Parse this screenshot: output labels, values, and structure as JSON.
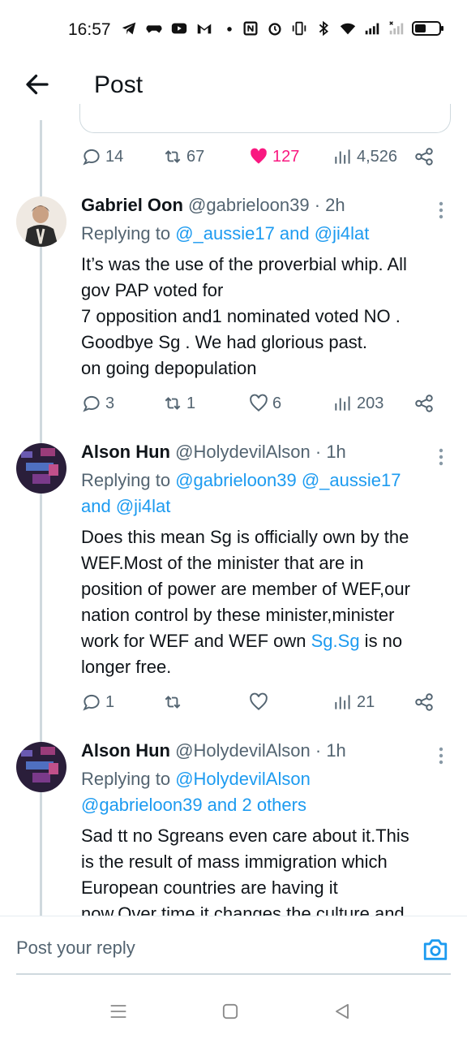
{
  "status_bar": {
    "time": "16:57",
    "icons": [
      "telegram-icon",
      "game-controller-icon",
      "youtube-icon",
      "gmail-icon",
      "dot-icon",
      "nfc-icon",
      "alarm-icon",
      "vibrate-icon",
      "bluetooth-icon",
      "wifi-icon",
      "signal-icon",
      "signal-no-service-icon",
      "battery-icon"
    ],
    "battery_level": 0.45
  },
  "header": {
    "title": "Post"
  },
  "colors": {
    "accent": "#1d9bf0",
    "like": "#f91880",
    "muted": "#536471",
    "text": "#0f1419"
  },
  "top_post_actions": {
    "replies": "14",
    "reposts": "67",
    "likes": "127",
    "views": "4,526"
  },
  "tweets": [
    {
      "name": "Gabriel Oon",
      "handle": "@gabrieloon39",
      "time": "· 2h",
      "replying_prefix": "Replying to ",
      "replying_mentions": "@_aussie17 and @ji4lat",
      "body_lines": [
        "It’s was the use of the proverbial  whip. All",
        "gov PAP voted for",
        "7 opposition and1  nominated voted NO .",
        "Goodbye Sg . We had glorious past.",
        "on going depopulation"
      ],
      "replies": "3",
      "reposts": "1",
      "likes": "6",
      "views": "203"
    },
    {
      "name": "Alson Hun",
      "handle": "@HolydevilAlson",
      "time": "· 1h",
      "replying_prefix": "Replying to ",
      "replying_mentions_1": "@gabrieloon39 @_aussie17",
      "replying_mentions_2": "and @ji4lat",
      "body_lines": [
        "Does this mean Sg is officially own by the",
        "WEF.Most of the minister that are in",
        "position of power are member of WEF,our",
        "nation control by these minister,minister",
        "work for WEF and WEF own "
      ],
      "body_link": "Sg.Sg",
      "body_after_link": " is no",
      "body_last": "longer free.",
      "replies": "1",
      "reposts": "",
      "likes": "",
      "views": "21"
    },
    {
      "name": "Alson Hun",
      "handle": "@HolydevilAlson",
      "time": "· 1h",
      "replying_prefix": "Replying to ",
      "replying_mentions_1": "@HolydevilAlson",
      "replying_mentions_2": "@gabrieloon39 and 2 others",
      "body_lines": [
        "Sad tt no Sgreans even care about it.This",
        "is the result of mass immigration which",
        "European countries are having it",
        "now.Over time it changes the culture and"
      ]
    }
  ],
  "reply_bar": {
    "placeholder": "Post your reply"
  }
}
